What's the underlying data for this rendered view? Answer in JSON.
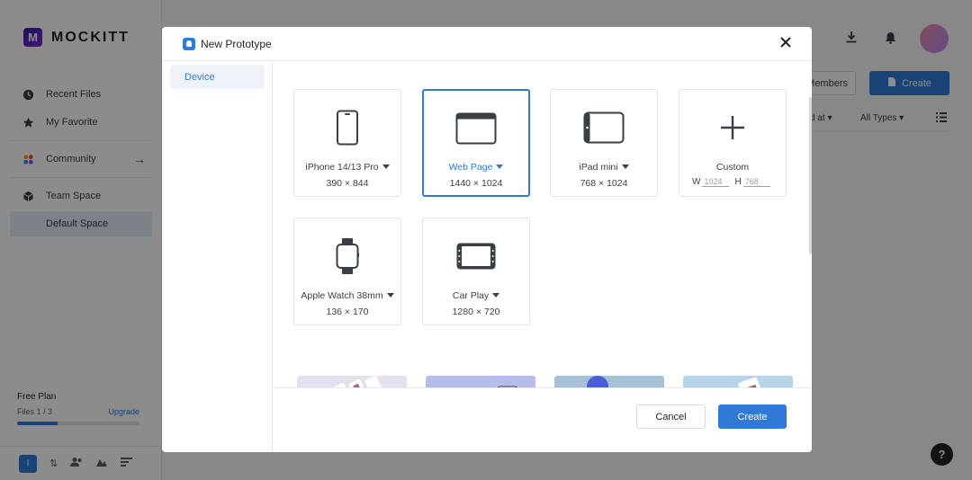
{
  "app": {
    "logo_letter": "M",
    "logo_text": "MOCKITT"
  },
  "sidebar": {
    "items": [
      {
        "label": "Recent Files",
        "icon": "clock-icon"
      },
      {
        "label": "My Favorite",
        "icon": "star-icon"
      },
      {
        "label": "Community",
        "icon": "community-icon"
      },
      {
        "label": "Team Space",
        "icon": "cube-icon"
      },
      {
        "label": "Default Space"
      }
    ],
    "plan": {
      "title": "Free Plan",
      "files": "Files 1 / 3",
      "upgrade": "Upgrade",
      "usage_fraction": 0.33
    },
    "team_badge": "I"
  },
  "header": {
    "members_label": "Members",
    "create_label": "Create",
    "sort_label": "d at",
    "types_label": "All Types"
  },
  "help": {
    "label": "?"
  },
  "modal": {
    "title": "New Prototype",
    "tabs": [
      "Device"
    ],
    "devices": [
      {
        "name": "iPhone 14/13 Pro",
        "size": "390 × 844"
      },
      {
        "name": "Web Page",
        "size": "1440 × 1024",
        "selected": true
      },
      {
        "name": "iPad mini",
        "size": "768 × 1024"
      },
      {
        "name": "Custom",
        "w_label": "W",
        "w_value": "1024",
        "h_label": "H",
        "h_value": "768"
      },
      {
        "name": "Apple Watch 38mm",
        "size": "136 × 170"
      },
      {
        "name": "Car Play",
        "size": "1280 × 720"
      }
    ],
    "cancel_label": "Cancel",
    "create_label": "Create",
    "accent_color": "#2f7ad8"
  }
}
